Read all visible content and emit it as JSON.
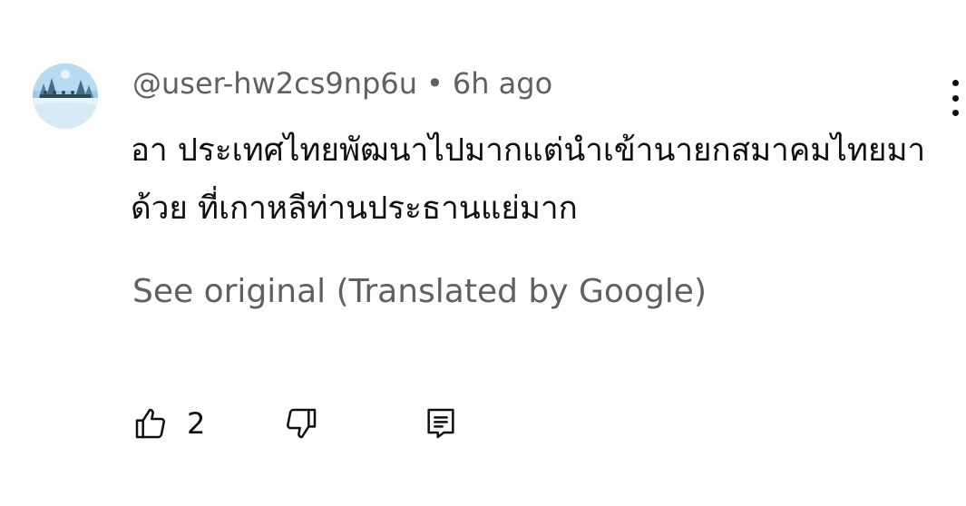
{
  "comment": {
    "author": "@user-hw2cs9np6u",
    "separator": "•",
    "time": "6h ago",
    "text": "อา ประเทศไทยพัฒนาไปมากแต่นำเข้านายกสมาคมไทยมาด้วย ที่เกาหลีท่านประธานแย่มาก",
    "translation_link": "See original (Translated by Google)",
    "like_count": "2"
  },
  "icons": {
    "avatar": "winter-landscape-avatar",
    "menu": "more-vertical-icon",
    "like": "thumbs-up-icon",
    "dislike": "thumbs-down-icon",
    "reply": "reply-comment-icon"
  },
  "colors": {
    "primary_text": "#0f0f0f",
    "secondary_text": "#606060",
    "background": "#ffffff"
  }
}
